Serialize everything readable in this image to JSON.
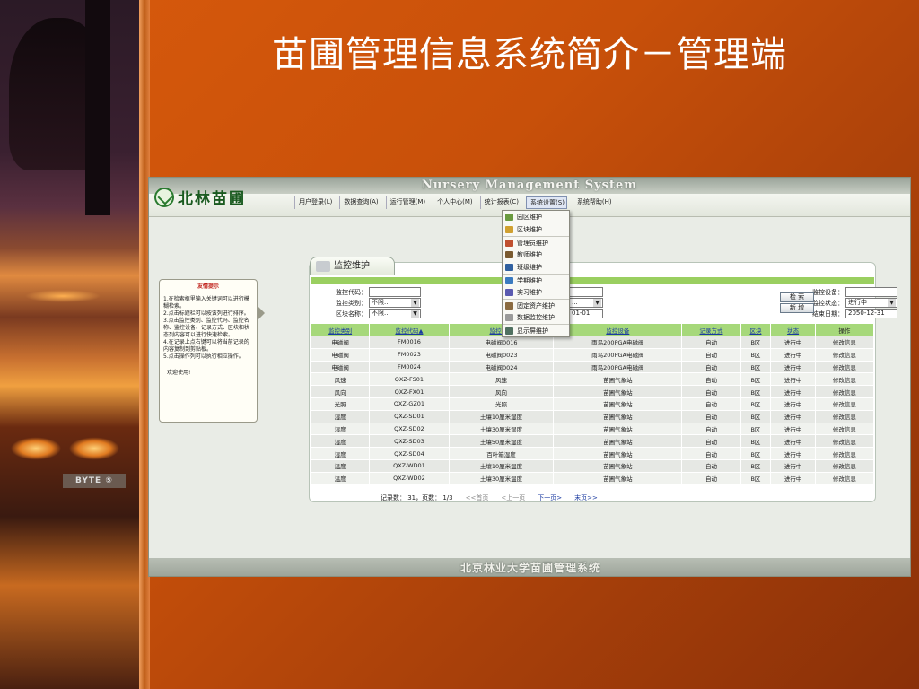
{
  "slide": {
    "title": "苗圃管理信息系统简介－管理端",
    "photo_plate": "BYTE ⑤"
  },
  "app": {
    "banner": "Nursery Management System",
    "logo_text": "北林苗圃",
    "menu": [
      {
        "label": "用户登录(L)"
      },
      {
        "label": "数据查询(A)"
      },
      {
        "label": "运行管理(M)"
      },
      {
        "label": "个人中心(M)"
      },
      {
        "label": "统计报表(C)"
      },
      {
        "label": "系统设置(S)"
      },
      {
        "label": "系统帮助(H)"
      }
    ],
    "dropdown": [
      {
        "label": "园区维护",
        "color": "#6a9a40"
      },
      {
        "label": "区块维护",
        "color": "#d0a030"
      },
      {
        "label": "管理员维护",
        "color": "#c05030"
      },
      {
        "label": "教师维护",
        "color": "#7a5a30"
      },
      {
        "label": "班级维护",
        "color": "#3060a0"
      },
      {
        "label": "学期维护",
        "color": "#3a7ac0"
      },
      {
        "label": "实习维护",
        "color": "#5a5ab0"
      },
      {
        "label": "固定资产维护",
        "color": "#8a6a40"
      },
      {
        "label": "数据监控维护",
        "color": "#9a9a9a"
      },
      {
        "label": "显示屏维护",
        "color": "#507060"
      }
    ],
    "tip": {
      "title": "友情提示",
      "items": [
        "1.在检索框里输入关键词可以进行模糊检索。",
        "2.点击标题栏可以按该列进行排序。",
        "3.点击监控类别、监控代码、监控名称、监控设备、记录方式、区块和状态列内容可以进行快速检索。",
        "4.在记录上点右键可以将当前记录的内容复制到剪贴板。",
        "5.点击操作列可以执行相应操作。"
      ],
      "footer": "欢迎使用!"
    },
    "panel_title": "监控维护",
    "filters": {
      "code_label": "监控代码：",
      "type_label": "监控类别：",
      "type_value": "不限...",
      "area_label": "区块名称：",
      "area_value": "不限...",
      "mid_select": "...",
      "mid_date": "01-01",
      "device_label": "监控设备：",
      "status_label": "监控状态：",
      "status_value": "进行中",
      "end_label": "结束日期：",
      "end_value": "2050-12-31",
      "search_btn": "检 索",
      "add_btn": "新 增"
    },
    "columns": [
      "监控类别",
      "监控代码▲",
      "监控名称",
      "监控设备",
      "记录方式",
      "区块",
      "状态",
      "操作"
    ],
    "rows": [
      [
        "电磁阀",
        "FM0016",
        "电磁阀0016",
        "雨鸟200PGA电磁阀",
        "自动",
        "B区",
        "进行中",
        "修改信息"
      ],
      [
        "电磁阀",
        "FM0023",
        "电磁阀0023",
        "雨鸟200PGA电磁阀",
        "自动",
        "B区",
        "进行中",
        "修改信息"
      ],
      [
        "电磁阀",
        "FM0024",
        "电磁阀0024",
        "雨鸟200PGA电磁阀",
        "自动",
        "B区",
        "进行中",
        "修改信息"
      ],
      [
        "风速",
        "QXZ-FS01",
        "风速",
        "苗圃气象站",
        "自动",
        "B区",
        "进行中",
        "修改信息"
      ],
      [
        "风向",
        "QXZ-FX01",
        "风向",
        "苗圃气象站",
        "自动",
        "B区",
        "进行中",
        "修改信息"
      ],
      [
        "光照",
        "QXZ-GZ01",
        "光照",
        "苗圃气象站",
        "自动",
        "B区",
        "进行中",
        "修改信息"
      ],
      [
        "湿度",
        "QXZ-SD01",
        "土壤10厘米湿度",
        "苗圃气象站",
        "自动",
        "B区",
        "进行中",
        "修改信息"
      ],
      [
        "湿度",
        "QXZ-SD02",
        "土壤30厘米湿度",
        "苗圃气象站",
        "自动",
        "B区",
        "进行中",
        "修改信息"
      ],
      [
        "湿度",
        "QXZ-SD03",
        "土壤50厘米湿度",
        "苗圃气象站",
        "自动",
        "B区",
        "进行中",
        "修改信息"
      ],
      [
        "湿度",
        "QXZ-SD04",
        "百叶箱湿度",
        "苗圃气象站",
        "自动",
        "B区",
        "进行中",
        "修改信息"
      ],
      [
        "温度",
        "QXZ-WD01",
        "土壤10厘米温度",
        "苗圃气象站",
        "自动",
        "B区",
        "进行中",
        "修改信息"
      ],
      [
        "温度",
        "QXZ-WD02",
        "土壤30厘米温度",
        "苗圃气象站",
        "自动",
        "B区",
        "进行中",
        "修改信息"
      ]
    ],
    "pager": {
      "summary": "记录数： 31，页数： 1/3",
      "first": "<<首页",
      "prev": "<上一页",
      "next": "下一页>",
      "last": "末页>>"
    },
    "footer": "北京林业大学苗圃管理系统"
  }
}
